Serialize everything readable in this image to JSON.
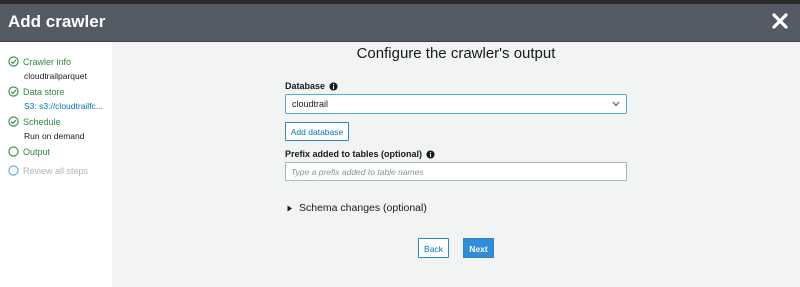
{
  "header": {
    "title": "Add crawler"
  },
  "sidebar": {
    "steps": [
      {
        "label": "Crawler info",
        "sub": "cloudtrailparquet"
      },
      {
        "label": "Data store",
        "sub": "S3: s3://cloudtrailfc..."
      },
      {
        "label": "Schedule",
        "sub": "Run on demand"
      },
      {
        "label": "Output"
      },
      {
        "label": "Review all steps"
      }
    ]
  },
  "main": {
    "heading": "Configure the crawler's output",
    "database": {
      "label": "Database",
      "value": "cloudtrail"
    },
    "add_database_label": "Add database",
    "prefix": {
      "label": "Prefix added to tables (optional)",
      "placeholder": "Type a prefix added to table names"
    },
    "schema_changes_label": "Schema changes (optional)",
    "back_label": "Back",
    "next_label": "Next"
  },
  "colors": {
    "header": "#545b64",
    "success": "#2d8a3e",
    "primary": "#2e8fd8",
    "link": "#0073bb"
  }
}
